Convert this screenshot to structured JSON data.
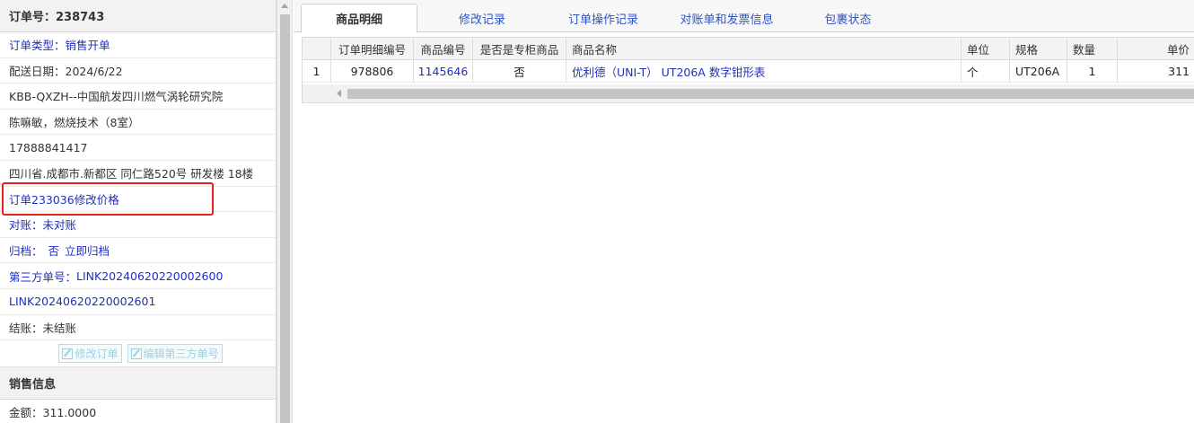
{
  "order": {
    "header": "订单号：238743",
    "type_label": "订单类型：",
    "type_value": "销售开单",
    "delivery_date": "配送日期：2024/6/22",
    "customer": "KBB-QXZH--中国航发四川燃气涡轮研究院",
    "contact": "陈嘛敏，燃烧技术（8室）",
    "phone": "17888841417",
    "address": "四川省.成都市.新都区 同仁路520号 研发楼 18楼",
    "price_modify_link": "订单233036修改价格",
    "reconcile_label": "对账：",
    "reconcile_value": "未对账",
    "archive_label": "归档：",
    "archive_value": "否",
    "archive_action": "立即归档",
    "third_party_label": "第三方单号：",
    "third_party_1": "LINK20240620220002600",
    "third_party_2": "LINK20240620220002601",
    "settle": "结账：未结账",
    "btn_modify": "修改订单",
    "btn_edit_third": "编辑第三方单号"
  },
  "sales": {
    "header": "销售信息",
    "amount": "金额：311.0000"
  },
  "tabs": [
    "商品明细",
    "修改记录",
    "订单操作记录",
    "对账单和发票信息",
    "包裹状态"
  ],
  "table": {
    "columns": [
      "订单明细编号",
      "商品编号",
      "是否是专柜商品",
      "商品名称",
      "单位",
      "规格",
      "数量",
      "单价"
    ],
    "rows": [
      {
        "index": "1",
        "detail_no": "978806",
        "product_no": "1145646",
        "counter": "否",
        "name": "优利德（UNI-T） UT206A 数字钳形表",
        "unit": "个",
        "spec": "UT206A",
        "qty": "1",
        "price": "311"
      }
    ]
  },
  "colors": {
    "link_blue": "#1f2fbf",
    "tab_blue": "#2d54c8",
    "highlight_red": "#e4231b"
  }
}
